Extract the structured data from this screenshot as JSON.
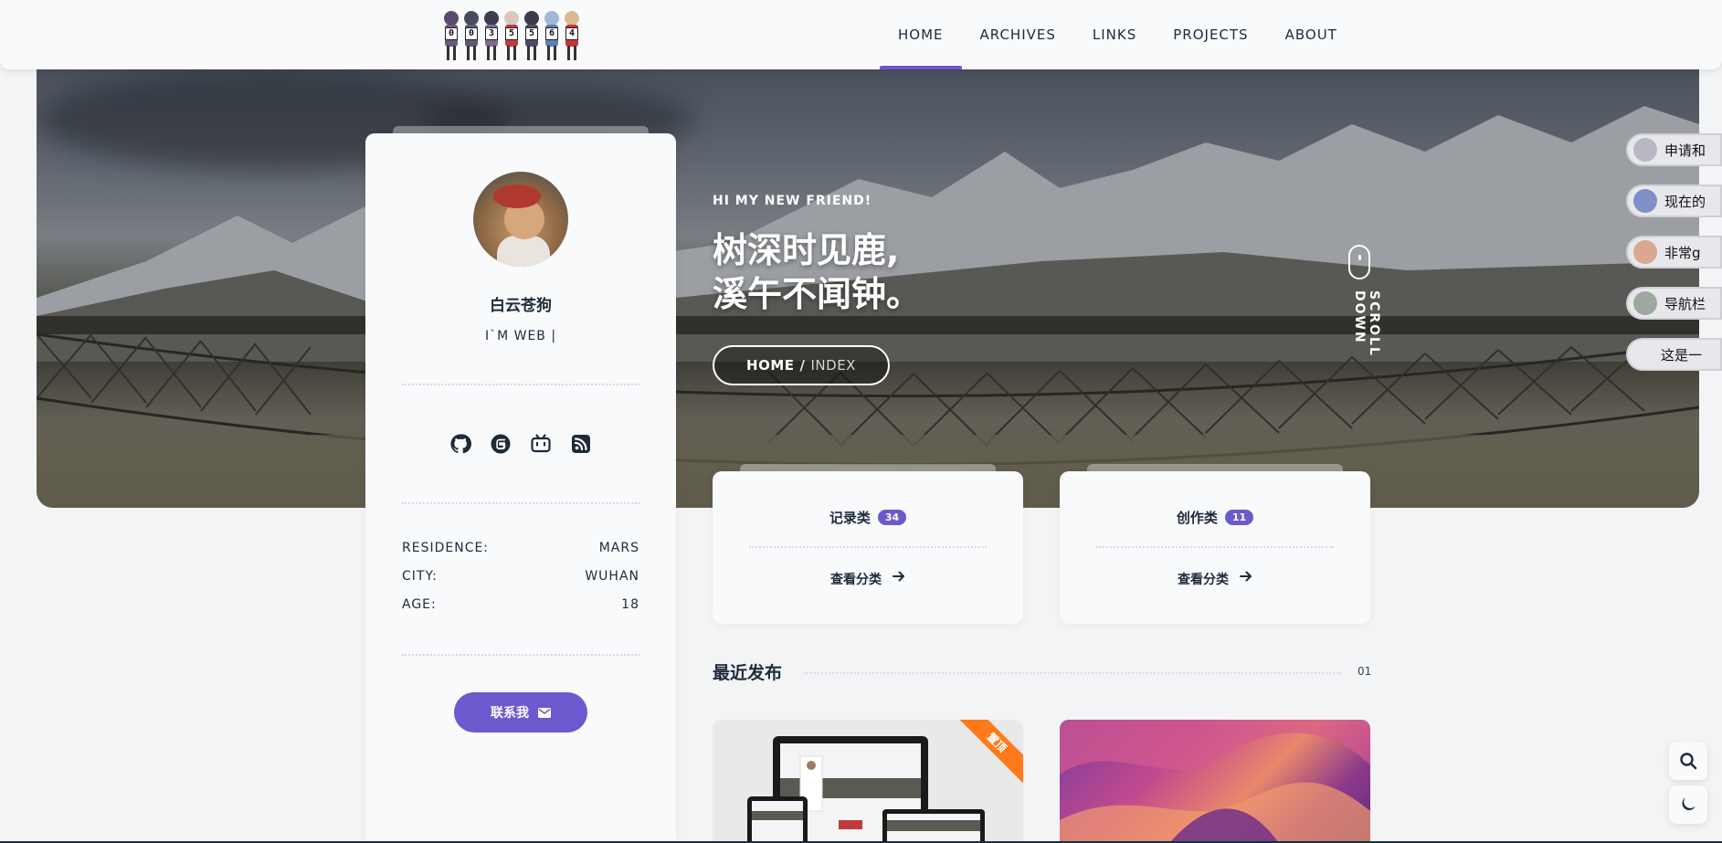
{
  "nav": {
    "logo_digits": [
      "0",
      "0",
      "3",
      "5",
      "5",
      "6",
      "4"
    ],
    "items": [
      {
        "label": "HOME",
        "active": true
      },
      {
        "label": "ARCHIVES",
        "active": false
      },
      {
        "label": "LINKS",
        "active": false
      },
      {
        "label": "PROJECTS",
        "active": false
      },
      {
        "label": "ABOUT",
        "active": false
      }
    ]
  },
  "hero": {
    "greeting": "HI MY NEW FRIEND!",
    "slogan_line1": "树深时见鹿,",
    "slogan_line2": "溪午不闻钟。",
    "breadcrumb_home": "HOME",
    "breadcrumb_sep": "/",
    "breadcrumb_current": "INDEX",
    "scroll_label": "SCROLL DOWN"
  },
  "bubbles": [
    {
      "text": "申请和",
      "avatar": "avatar-1"
    },
    {
      "text": "现在的",
      "avatar": "avatar-2"
    },
    {
      "text": "非常g",
      "avatar": "avatar-3"
    },
    {
      "text": "导航栏",
      "avatar": "avatar-4"
    },
    {
      "text": "这是一",
      "avatar": null
    }
  ],
  "profile": {
    "name": "白云苍狗",
    "tagline": "I`M WEB |",
    "social": [
      "github-icon",
      "gitee-icon",
      "bilibili-icon",
      "rss-icon"
    ],
    "info": [
      {
        "key": "RESIDENCE:",
        "value": "MARS"
      },
      {
        "key": "CITY:",
        "value": "WUHAN"
      },
      {
        "key": "AGE:",
        "value": "18"
      }
    ],
    "contact_label": "联系我"
  },
  "categories": [
    {
      "title": "记录类",
      "count": "34",
      "link": "查看分类"
    },
    {
      "title": "创作类",
      "count": "11",
      "link": "查看分类"
    }
  ],
  "recent": {
    "title": "最近发布",
    "page": "01",
    "posts": [
      {
        "ribbon": "置顶"
      },
      {
        "ribbon": ""
      }
    ]
  },
  "colors": {
    "accent": "#6a5acd",
    "ribbon": "#ff7b1a",
    "text": "#1e2a3a",
    "background": "#f3f4f6"
  }
}
